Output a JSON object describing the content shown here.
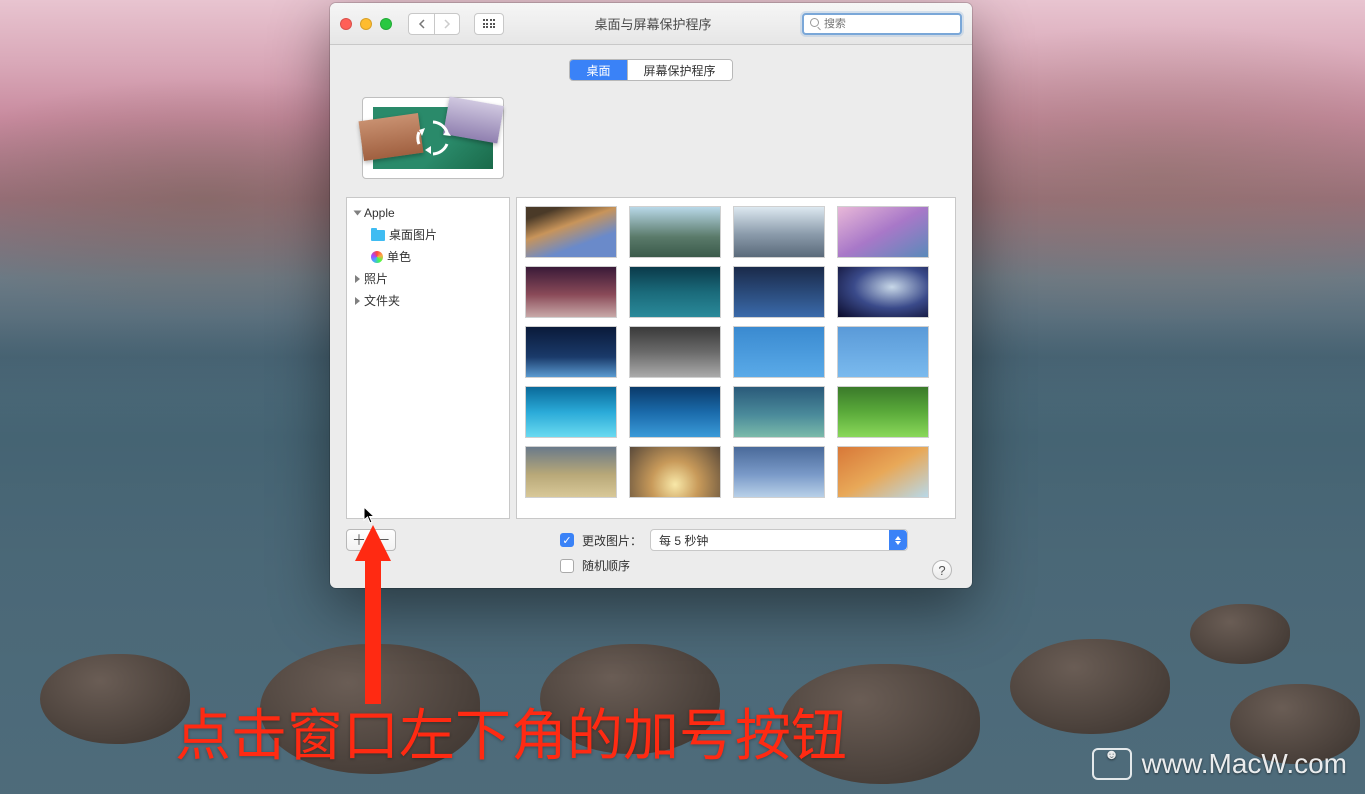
{
  "window": {
    "title": "桌面与屏幕保护程序",
    "search_placeholder": "搜索"
  },
  "tabs": {
    "desktop": "桌面",
    "screensaver": "屏幕保护程序"
  },
  "sidebar": {
    "apple": "Apple",
    "desktop_pictures": "桌面图片",
    "solid_colors": "单色",
    "photos": "照片",
    "folders": "文件夹"
  },
  "footer": {
    "change_picture": "更改图片：",
    "interval": "每 5 秒钟",
    "random_order": "随机顺序"
  },
  "thumbs": [
    {
      "bg": "linear-gradient(160deg,#4a3a28 15%,#c8945a 40%,#6a8aca 70%)"
    },
    {
      "bg": "linear-gradient(#b8d8e8,#5a7a6a 60%,#3a5a4a)"
    },
    {
      "bg": "linear-gradient(#dce8f0,#8a9aaa 55%,#5a6a7a)"
    },
    {
      "bg": "linear-gradient(150deg,#e8b8d8,#a878c8 50%,#5a8aba)"
    },
    {
      "bg": "linear-gradient(#3a1a38,#8a4a58 55%,#c8a8a8)"
    },
    {
      "bg": "linear-gradient(#0a3a4a,#1a6a7a 50%,#2a8a9a)"
    },
    {
      "bg": "linear-gradient(#1a2a4a,#2a4a7a 50%,#3a6aaa)"
    },
    {
      "bg": "radial-gradient(ellipse at 60% 40%,#c8d8e8,#3a4a8a 50%,#0a0a2a)"
    },
    {
      "bg": "linear-gradient(#0a1a3a,#1a3a6a 60%,#5a9ad0)"
    },
    {
      "bg": "linear-gradient(#3a3a3a,#6a6a6a 50%,#aaa)"
    },
    {
      "bg": "linear-gradient(#3a8ad0,#5aaae8)"
    },
    {
      "bg": "linear-gradient(#5a9ad8,#7abaee)"
    },
    {
      "bg": "linear-gradient(#0a6a9a,#2aaad8 50%,#6adaf0)"
    },
    {
      "bg": "linear-gradient(#0a3a6a,#1a6aaa 50%,#3a9ad8)"
    },
    {
      "bg": "linear-gradient(#2a5a7a,#4a8a9a 55%,#7abaaa)"
    },
    {
      "bg": "linear-gradient(#3a7a2a,#5aaa3a 50%,#8ad85a)"
    },
    {
      "bg": "linear-gradient(#6a7a8a,#b8a878 55%,#d8c898)"
    },
    {
      "bg": "radial-gradient(circle at 50% 75%,#f8e8a8,#c89a5a 40%,#5a4a3a)"
    },
    {
      "bg": "linear-gradient(#4a6a9a,#7a9ac8 55%,#b8d0e8)"
    },
    {
      "bg": "linear-gradient(150deg,#d87838,#e8a858 50%,#b8d8e8)"
    }
  ],
  "annotation": {
    "caption": "点击窗口左下角的加号按钮"
  },
  "watermark": "www.MacW.com"
}
